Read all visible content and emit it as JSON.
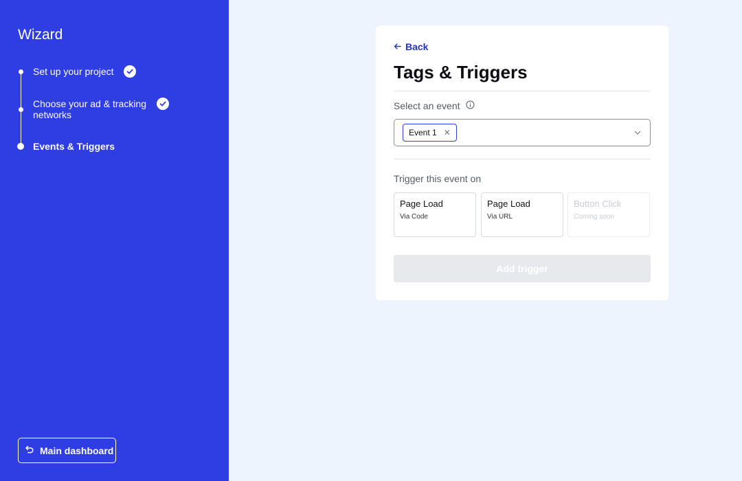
{
  "sidebar": {
    "brand": "Wizard",
    "steps": [
      {
        "label": "Set up your project",
        "completed": true
      },
      {
        "label": "Choose your ad & tracking networks",
        "completed": true
      },
      {
        "label": "Events & Triggers",
        "completed": false,
        "active": true
      }
    ],
    "dashboard_button": "Main dashboard",
    "dashboard_icon": "undo-arrow-icon",
    "background": "#2e3ee3"
  },
  "card": {
    "back_label": "Back",
    "title": "Tags & Triggers",
    "select_event_label": "Select an event",
    "selected_event": "Event 1",
    "trigger_label": "Trigger this event on",
    "options": [
      {
        "title": "Page Load",
        "subtitle": "Via Code",
        "disabled": false
      },
      {
        "title": "Page Load",
        "subtitle": "Via URL",
        "disabled": false
      },
      {
        "title": "Button Click",
        "subtitle": "Coming soon",
        "disabled": true
      }
    ],
    "add_button": "Add trigger",
    "add_button_disabled": true
  },
  "colors": {
    "accent": "#2e3ee3",
    "link": "#2433c9",
    "page_bg": "#eef4fd"
  }
}
